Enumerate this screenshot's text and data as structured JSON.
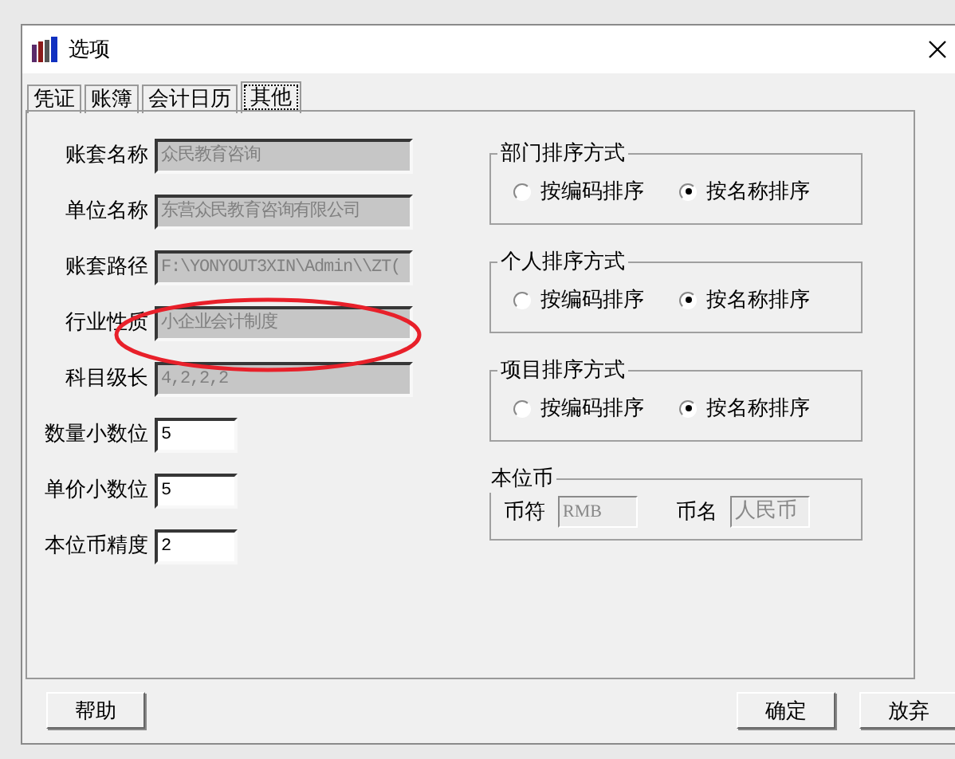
{
  "window": {
    "title": "选项"
  },
  "tabs": [
    {
      "label": "凭证",
      "selected": false
    },
    {
      "label": "账簿",
      "selected": false
    },
    {
      "label": "会计日历",
      "selected": false
    },
    {
      "label": "其他",
      "selected": true
    }
  ],
  "fields": [
    {
      "label": "账套名称",
      "value": "众民教育咨询",
      "disabled": true
    },
    {
      "label": "单位名称",
      "value": "东营众民教育咨询有限公司",
      "disabled": true
    },
    {
      "label": "账套路径",
      "value": "F:\\YONYOUT3XIN\\Admin\\\\ZT(",
      "disabled": true
    },
    {
      "label": "行业性质",
      "value": "小企业会计制度",
      "disabled": true
    },
    {
      "label": "科目级长",
      "value": "4,2,2,2",
      "disabled": true
    },
    {
      "label": "数量小数位",
      "value": "5",
      "disabled": false
    },
    {
      "label": "单价小数位",
      "value": "5",
      "disabled": false
    },
    {
      "label": "本位币精度",
      "value": "2",
      "disabled": false
    }
  ],
  "sort_groups": [
    {
      "title": "部门排序方式",
      "options": [
        {
          "label": "按编码排序",
          "selected": false
        },
        {
          "label": "按名称排序",
          "selected": true
        }
      ]
    },
    {
      "title": "个人排序方式",
      "options": [
        {
          "label": "按编码排序",
          "selected": false
        },
        {
          "label": "按名称排序",
          "selected": true
        }
      ]
    },
    {
      "title": "项目排序方式",
      "options": [
        {
          "label": "按编码排序",
          "selected": false
        },
        {
          "label": "按名称排序",
          "selected": true
        }
      ]
    }
  ],
  "currency": {
    "title": "本位币",
    "fields": [
      {
        "label": "币符",
        "value": "RMB",
        "disabled": true
      },
      {
        "label": "币名",
        "value": "人民币",
        "disabled": true
      }
    ]
  },
  "buttons_left": [
    "帮助"
  ],
  "buttons_right": [
    "确定",
    "放弃"
  ]
}
